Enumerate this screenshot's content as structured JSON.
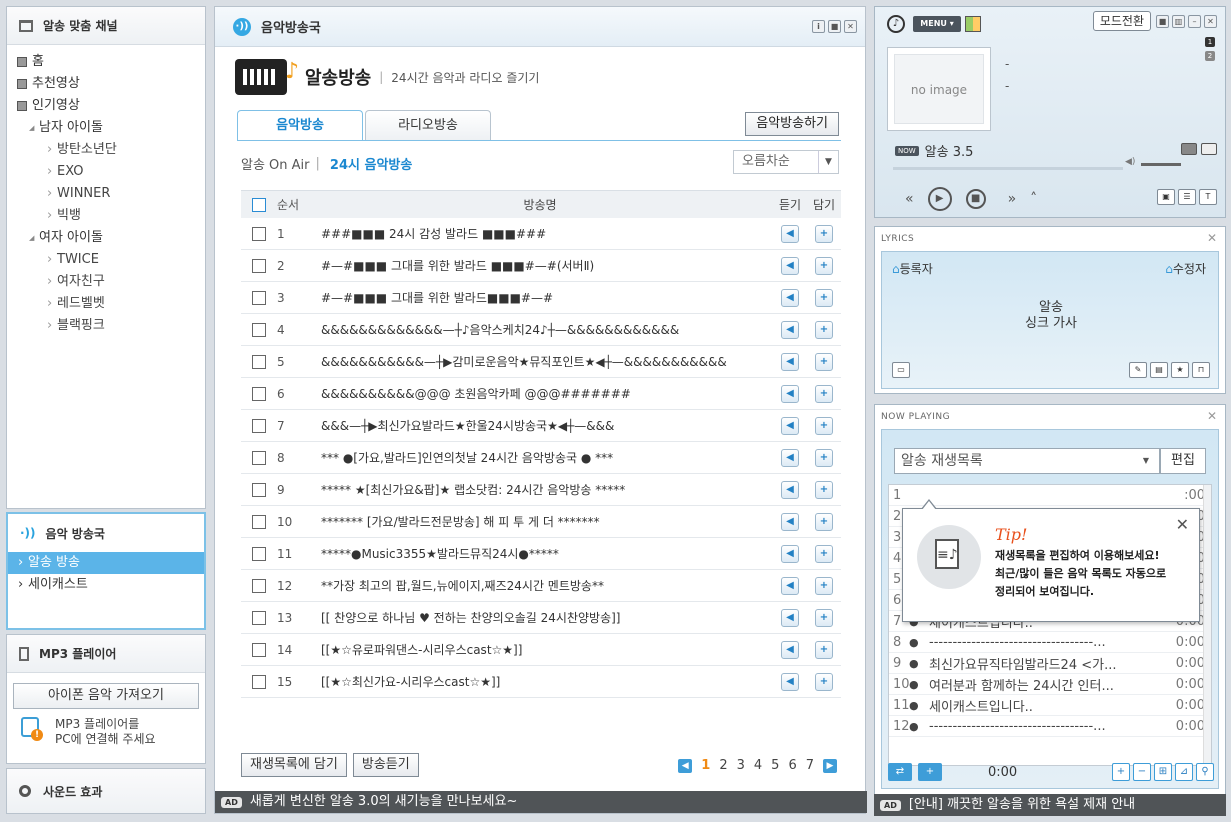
{
  "left": {
    "channel_title": "알송 맞춤 채널",
    "tree": [
      {
        "level": 0,
        "label": "홈"
      },
      {
        "level": 0,
        "label": "추천영상"
      },
      {
        "level": 0,
        "label": "인기영상"
      },
      {
        "level": 1,
        "label": "남자 아이돌"
      },
      {
        "level": 2,
        "label": "방탄소년단"
      },
      {
        "level": 2,
        "label": "EXO"
      },
      {
        "level": 2,
        "label": "WINNER"
      },
      {
        "level": 2,
        "label": "빅뱅"
      },
      {
        "level": 1,
        "label": "여자 아이돌"
      },
      {
        "level": 2,
        "label": "TWICE"
      },
      {
        "level": 2,
        "label": "여자친구"
      },
      {
        "level": 2,
        "label": "레드벨벳"
      },
      {
        "level": 2,
        "label": "블랙핑크"
      }
    ],
    "radio_title": "음악 방송국",
    "radio_items": [
      "알송 방송",
      "세이캐스트"
    ],
    "mp3_title": "MP3 플레이어",
    "mp3_button": "아이폰 음악 가져오기",
    "mp3_info_1": "MP3 플레이어를",
    "mp3_info_2": "PC에 연결해 주세요",
    "sound_title": "사운드 효과"
  },
  "center": {
    "window_title": "음악방송국",
    "hero_title": "알송방송",
    "hero_sep": "|",
    "hero_sub": "24시간 음악과 라디오 즐기기",
    "tabs": [
      "음악방송",
      "라디오방송"
    ],
    "action_button": "음악방송하기",
    "sub_prefix": "알송 On Air",
    "sub_sep": "|",
    "sub_current": "24시 음악방송",
    "sort_label": "오름차순",
    "columns": {
      "no": "순서",
      "name": "방송명",
      "listen": "듣기",
      "add": "담기"
    },
    "rows": [
      {
        "no": "1",
        "name": "###■■■ 24시 감성 발라드 ■■■###"
      },
      {
        "no": "2",
        "name": "#—#■■■ 그대를 위한 발라드 ■■■#—#(서버Ⅱ)"
      },
      {
        "no": "3",
        "name": "#—#■■■ 그대를 위한 발라드■■■#—#"
      },
      {
        "no": "4",
        "name": "&&&&&&&&&&&&&—┼♪음악스케치24♪┼—&&&&&&&&&&&&"
      },
      {
        "no": "5",
        "name": "&&&&&&&&&&&—┼▶감미로운음악★뮤직포인트★◀┼—&&&&&&&&&&&"
      },
      {
        "no": "6",
        "name": "&&&&&&&&&&@@@ 초원음악카페 @@@#######"
      },
      {
        "no": "7",
        "name": "&&&—┼▶최신가요발라드★한울24시방송국★◀┼—&&&"
      },
      {
        "no": "8",
        "name": "*** ●[가요,발라드]인연의첫날 24시간 음악방송국 ● ***"
      },
      {
        "no": "9",
        "name": "***** ★[최신가요&팝]★ 랩소닷컴: 24시간 음악방송 *****"
      },
      {
        "no": "10",
        "name": "******* [가요/발라드전문방송] 해 피 투 게 더 *******"
      },
      {
        "no": "11",
        "name": "*****●Music3355★발라드뮤직24시●*****"
      },
      {
        "no": "12",
        "name": "**가장 최고의 팝,월드,뉴에이지,째즈24시간 멘트방송**"
      },
      {
        "no": "13",
        "name": "[[ 찬양으로 하나님 ♥ 전하는 찬양의오솔길 24시찬양방송]]"
      },
      {
        "no": "14",
        "name": "[[★☆유로파워댄스-시리우스cast☆★]]"
      },
      {
        "no": "15",
        "name": "[[★☆최신가요-시리우스cast☆★]]"
      }
    ],
    "btn_add_playlist": "재생목록에 담기",
    "btn_listen": "방송듣기",
    "pages": [
      "1",
      "2",
      "3",
      "4",
      "5",
      "6",
      "7"
    ],
    "ticker": "새롭게 변신한 알송 3.0의 새기능을 만나보세요~"
  },
  "player": {
    "menu": "MENU",
    "mode_button": "모드전환",
    "no_image": "no image",
    "line1": "-",
    "line2": "-",
    "now_label": "알송 3.5",
    "badge1": "1",
    "badge2": "2"
  },
  "lyrics": {
    "title": "LYRICS",
    "registrant": "등록자",
    "editor": "수정자",
    "body1": "알송",
    "body2": "싱크 가사"
  },
  "nowplaying": {
    "title": "NOW PLAYING",
    "playlist": "알송 재생목록",
    "edit": "편집",
    "rows": [
      {
        "n": "1",
        "t": "",
        "d": ":00"
      },
      {
        "n": "2",
        "t": "",
        "d": ":00"
      },
      {
        "n": "3",
        "t": "",
        "d": ":00"
      },
      {
        "n": "4",
        "t": "",
        "d": ":00"
      },
      {
        "n": "5",
        "t": "",
        "d": ":00"
      },
      {
        "n": "6",
        "t": "여러분과 함께하는 24시간 인터...",
        "d": "0:00"
      },
      {
        "n": "7",
        "t": "세이캐스트입니다..",
        "d": "0:00"
      },
      {
        "n": "8",
        "t": "-----------------------------------...",
        "d": "0:00"
      },
      {
        "n": "9",
        "t": "최신가요뮤직타임발라드24 <가...",
        "d": "0:00"
      },
      {
        "n": "10",
        "t": "여러분과 함께하는 24시간 인터...",
        "d": "0:00"
      },
      {
        "n": "11",
        "t": "세이캐스트입니다..",
        "d": "0:00"
      },
      {
        "n": "12",
        "t": "-----------------------------------...",
        "d": "0:00"
      }
    ],
    "time": "0:00",
    "tip_title": "Tip!",
    "tip_line1": "재생목록을 편집하여 이용해보세요!",
    "tip_line2": "최근/많이 들은 음악 목록도 자동으로",
    "tip_line3": "정리되어 보여집니다.",
    "ticker": "[안내] 깨끗한 알송을 위한 욕설 제재 안내"
  }
}
